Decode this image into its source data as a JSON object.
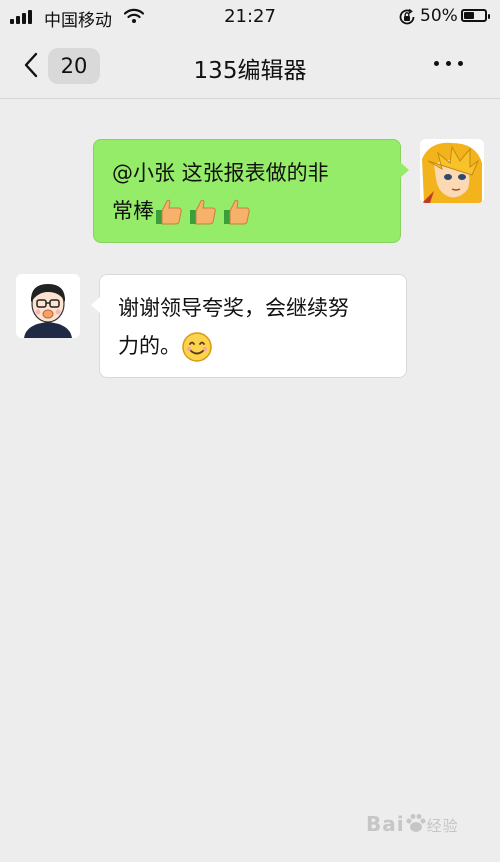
{
  "status_bar": {
    "carrier": "中国移动",
    "time": "21:27",
    "battery_percent": "50%",
    "battery_level": 0.5
  },
  "nav": {
    "back_badge": "20",
    "title": "135编辑器"
  },
  "messages": [
    {
      "direction": "sent",
      "text_line1": "@小张  这张报表做的非",
      "text_line2": "常棒",
      "emoji": [
        "thumbs-up",
        "thumbs-up",
        "thumbs-up"
      ]
    },
    {
      "direction": "received",
      "text_line1": "谢谢领导夸奖，会继续努",
      "text_line2": "力的。",
      "emoji": [
        "smile"
      ]
    }
  ],
  "watermark": {
    "text": "Bai",
    "suffix": "经验"
  },
  "colors": {
    "background": "#ededed",
    "sent_bubble": "#95ec69",
    "received_bubble": "#ffffff"
  }
}
